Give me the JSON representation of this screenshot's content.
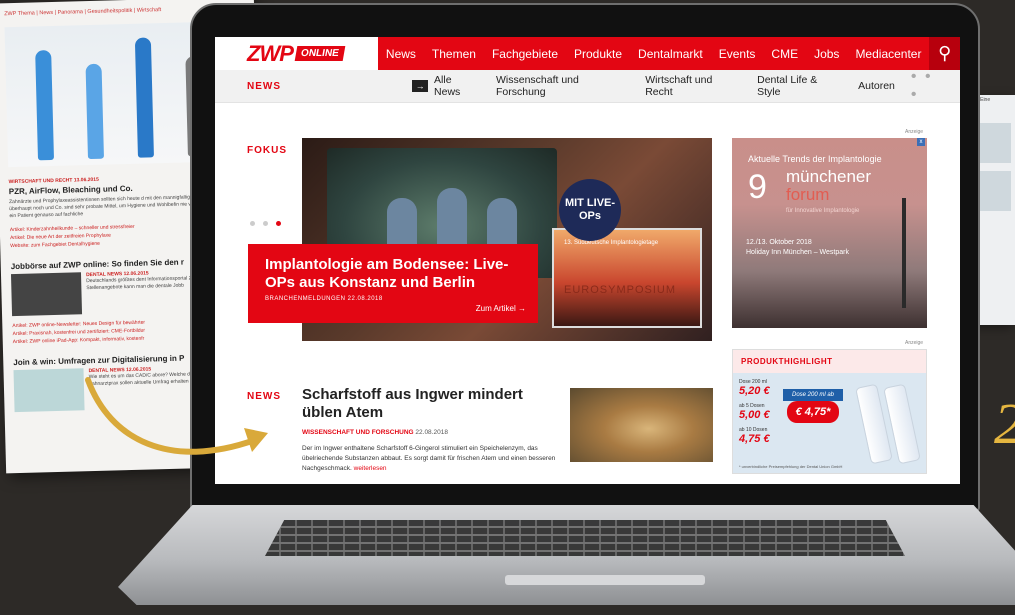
{
  "background_page": {
    "topnav": "ZWP Thema | News | Panorama | Gesundheitspolitik | Wirtschaft",
    "section1_kicker": "WIRTSCHAFT UND RECHT 13.06.2015",
    "section1_title": "PZR, AirFlow, Bleaching und Co.",
    "section1_text": "Zahnärzte und Prophylaxeassistentinnen sollten sich heute d mit den mannigfaltigen Maßnahmepaketen überhaupt noch und Co. sind sehr probate Mittel, um Hygiene und Wohlbefin nie vergessen werden, dass ein Patient genauso auf fachliche",
    "section1_links": [
      "Artikel:  Kinderzahnheilkunde – schneller und stressfreier",
      "Artikel:  Die neue Art der zeitfreien Prophylaxe",
      "Website:  zum Fachgebiet Dentalhygiene"
    ],
    "section2_title": "Jobbörse auf ZWP online: So finden Sie den r",
    "section2_kicker": "DENTAL NEWS 12.06.2015",
    "section2_text": "Deutschlands größtes dent Informationsportal ZWP nneuesten Stellenangebote kann man die dentale Jobb",
    "section2_links": [
      "Artikel:  ZWP online-Newsletter: Neues Design für bewährter",
      "Artikel:  Praxisnah, kostenfrei und zertifiziert: CME-Fortbildur",
      "Artikel:  ZWP online iPad-App: Kompakt, informativ, kostenfr"
    ],
    "section3_title": "Join & win: Umfragen zur Digitalisierung in P",
    "section3_kicker": "DENTAL NEWS 12.06.2015",
    "section3_text": "Wie steht es um das CAD/C abore? Welche digitalen A chlands Zahnarztprax sollen aktuelle Umfrag erhalten Sie einen Euro-Gutsc",
    "right_tag": "Revo-S - Eine",
    "right_link": "en",
    "yellow_char": "2"
  },
  "site": {
    "logo_main": "ZWP",
    "logo_badge": "ONLINE",
    "main_nav": [
      "News",
      "Themen",
      "Fachgebiete",
      "Produkte",
      "Dentalmarkt",
      "Events",
      "CME",
      "Jobs",
      "Mediacenter"
    ],
    "search_icon": "⚲",
    "sub_label": "NEWS",
    "sub_arrow": "→",
    "sub_nav": [
      "Alle News",
      "Wissenschaft und Forschung",
      "Wirtschaft und Recht",
      "Dental Life & Style",
      "Autoren"
    ],
    "sub_more": "• • •"
  },
  "fokus": {
    "label": "FOKUS",
    "headline": "Implantologie am Bodensee: Live-OPs aus Konstanz und Berlin",
    "meta": "BRANCHENMELDUNGEN 22.08.2018",
    "cta": "Zum Artikel  →",
    "projection_title": "13. Süddeutsche Implantologietage",
    "projection_big": "EUROSYMPOSIUM",
    "badge": "MIT LIVE-OPs"
  },
  "ad_muenchener": {
    "label": "Anzeige",
    "trend": "Aktuelle Trends der Implantologie",
    "num": "9",
    "line1": "münchener",
    "line2": "forum",
    "line3": "für Innovative Implantologie",
    "date1": "12./13. Oktober 2018",
    "date2": "Holiday Inn München – Westpark",
    "close": "x"
  },
  "news": {
    "label": "NEWS",
    "title": "Scharfstoff aus Ingwer mindert üblen Atem",
    "kicker": "WISSENSCHAFT UND FORSCHUNG",
    "date": "22.08.2018",
    "body": "Der im Ingwer enthaltene Scharfstoff 6-Gingerol stimuliert ein Speichelenzym, das übelriechende Substanzen abbaut. Es sorgt damit für frischen Atem und einen besseren Nachgeschmack.",
    "more": "weiterlesen"
  },
  "ad_produkt": {
    "label": "Anzeige",
    "header": "PRODUKTHIGHLIGHT",
    "prices": [
      {
        "caption": "Dose 200 ml",
        "value": "5,20 €"
      },
      {
        "caption": "ab 5 Dosen",
        "value": "5,00 €"
      },
      {
        "caption": "ab 10 Dosen",
        "value": "4,75 €"
      }
    ],
    "bubble_header": "Dose 200 ml ab",
    "bubble_price": "€ 4,75*",
    "footnote": "* unverbindliche Preisempfehlung der Dental Union GmbH"
  },
  "colors": {
    "brand_red": "#e30613",
    "accent_navy": "#1e2a58"
  }
}
